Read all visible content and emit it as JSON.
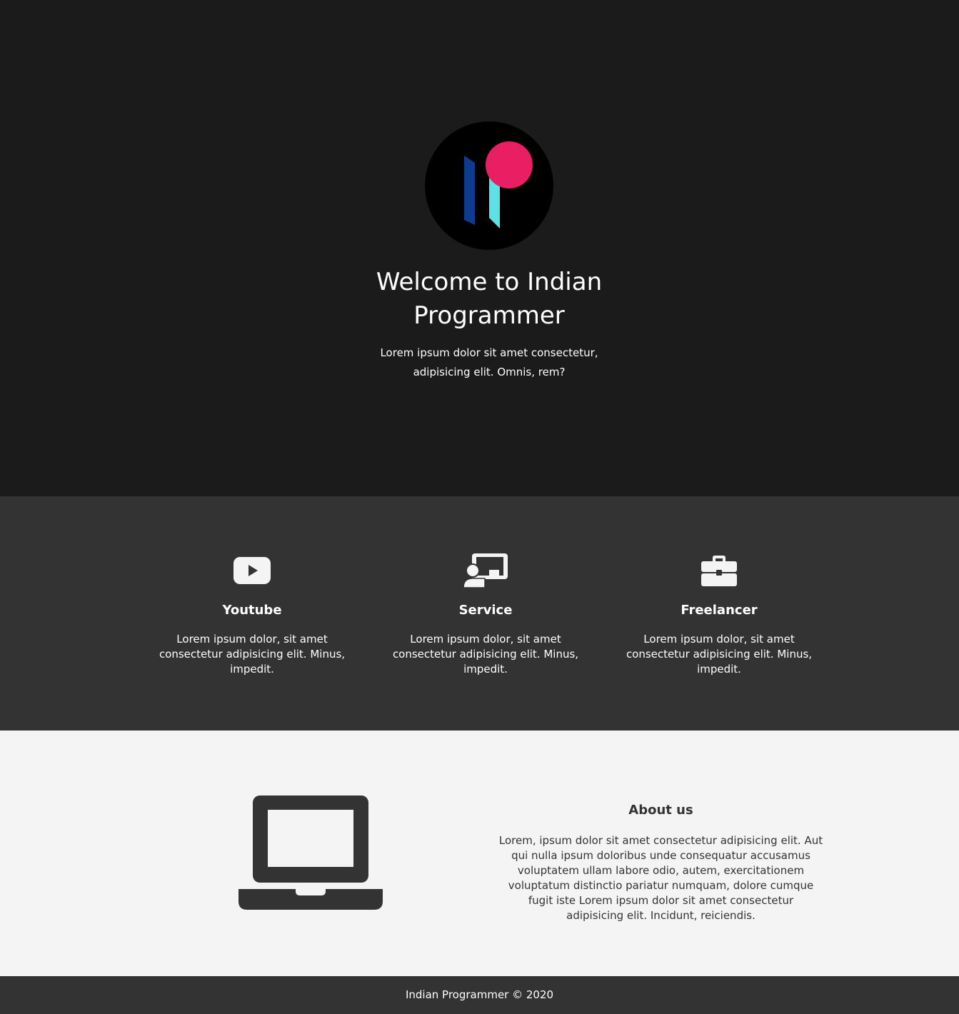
{
  "colors": {
    "hero_bg": "#1b1b1c",
    "section_bg": "#333333",
    "about_bg": "#f4f4f4",
    "logo_pink": "#e91e63",
    "logo_cyan": "#5ce1e6",
    "logo_navy": "#0d3b8f"
  },
  "hero": {
    "logo_icon": "indian-programmer-logo",
    "title": "Welcome to Indian Programmer",
    "text": "Lorem ipsum dolor sit amet consectetur, adipisicing elit. Omnis, rem?"
  },
  "services": [
    {
      "icon": "youtube-icon",
      "title": "Youtube",
      "text": "Lorem ipsum dolor, sit amet consectetur adipisicing elit. Minus, impedit."
    },
    {
      "icon": "chalkboard-teacher-icon",
      "title": "Service",
      "text": "Lorem ipsum dolor, sit amet consectetur adipisicing elit. Minus, impedit."
    },
    {
      "icon": "briefcase-icon",
      "title": "Freelancer",
      "text": "Lorem ipsum dolor, sit amet consectetur adipisicing elit. Minus, impedit."
    }
  ],
  "about": {
    "icon": "laptop-icon",
    "title": "About us",
    "text": "Lorem, ipsum dolor sit amet consectetur adipisicing elit. Aut qui nulla ipsum doloribus unde consequatur accusamus voluptatem ullam labore odio, autem, exercitationem voluptatum distinctio pariatur numquam, dolore cumque fugit iste Lorem ipsum dolor sit amet consectetur adipisicing elit. Incidunt, reiciendis."
  },
  "footer": {
    "text": "Indian Programmer © 2020"
  }
}
